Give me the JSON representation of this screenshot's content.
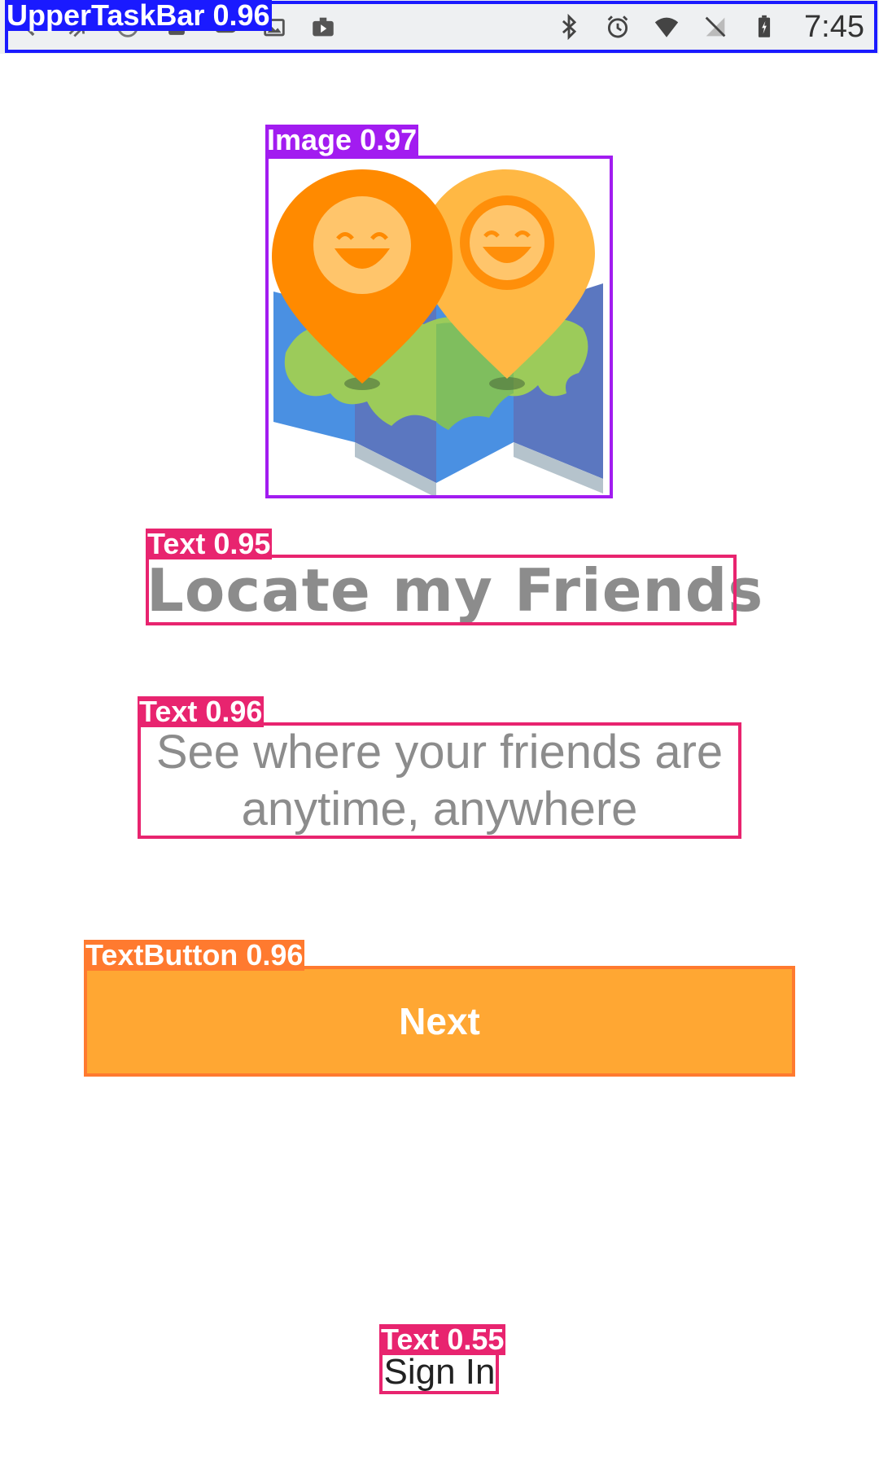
{
  "status_bar": {
    "time": "7:45",
    "left_icons": [
      "back-icon",
      "signal-tool-icon",
      "circle-app-icon",
      "download-icon",
      "cloud-icon",
      "photo-icon",
      "briefcase-play-icon"
    ],
    "right_icons": [
      "bluetooth-icon",
      "alarm-icon",
      "wifi-icon",
      "no-signal-icon",
      "battery-charging-icon"
    ]
  },
  "onboarding": {
    "title": "Locate my Friends",
    "subtitle": "See where your friends are anytime, anywhere",
    "next_label": "Next",
    "signin_label": "Sign In"
  },
  "colors": {
    "accent": "#ffa733",
    "text_gray": "#8c8c8c",
    "pin_dark": "#ff8a00",
    "pin_light": "#ffb844",
    "map_blue": "#4a90e2",
    "map_green": "#8bc34a"
  },
  "annotations": [
    {
      "label": "UpperTaskBar",
      "score": "0.96",
      "color": "#1a1aff"
    },
    {
      "label": "Image",
      "score": "0.97",
      "color": "#a21cf0"
    },
    {
      "label": "Text",
      "score": "0.95",
      "color": "#e8246f"
    },
    {
      "label": "Text",
      "score": "0.96",
      "color": "#e8246f"
    },
    {
      "label": "TextButton",
      "score": "0.96",
      "color": "#ff7a2f"
    },
    {
      "label": "Text",
      "score": "0.55",
      "color": "#e8246f"
    }
  ]
}
